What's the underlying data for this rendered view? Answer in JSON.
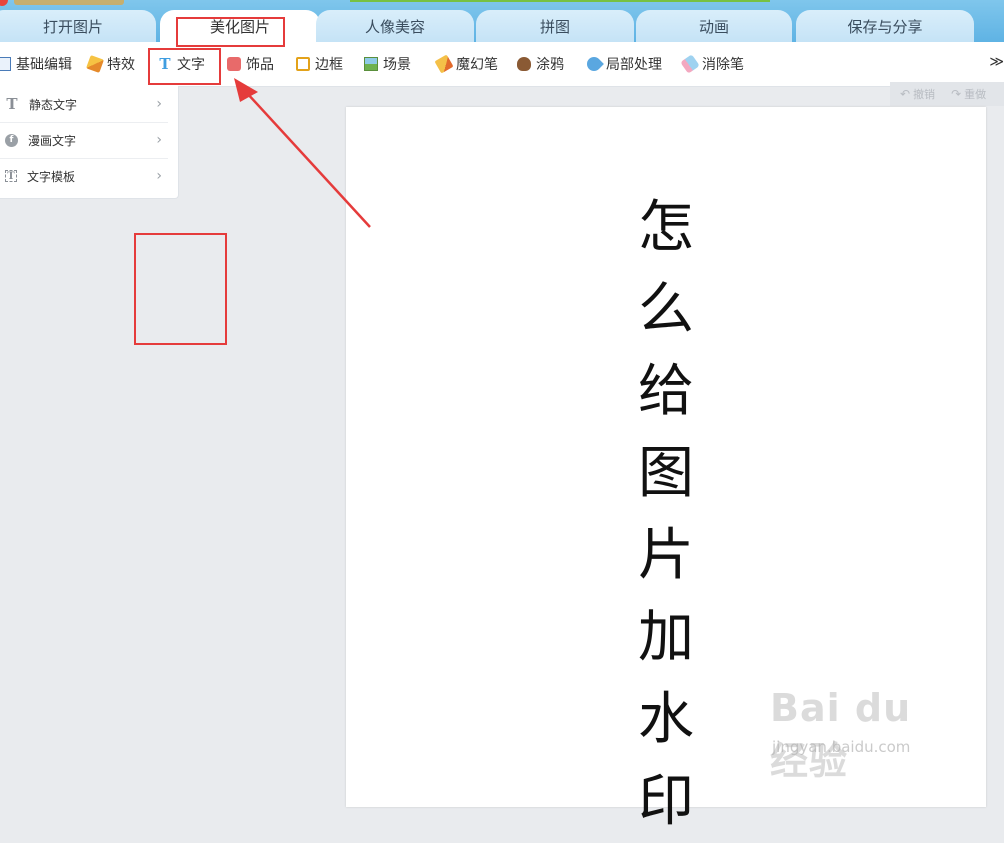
{
  "tabs": [
    {
      "label": "打开图片"
    },
    {
      "label": "美化图片",
      "active": true
    },
    {
      "label": "人像美容"
    },
    {
      "label": "拼图"
    },
    {
      "label": "动画"
    },
    {
      "label": "保存与分享"
    }
  ],
  "toolbar": {
    "items": [
      {
        "label": "基础编辑",
        "icon": "basic-edit-icon"
      },
      {
        "label": "特效",
        "icon": "effects-icon"
      },
      {
        "label": "文字",
        "icon": "text-icon"
      },
      {
        "label": "饰品",
        "icon": "decoration-icon"
      },
      {
        "label": "边框",
        "icon": "frame-icon"
      },
      {
        "label": "场景",
        "icon": "scene-icon"
      },
      {
        "label": "魔幻笔",
        "icon": "magic-pen-icon"
      },
      {
        "label": "涂鸦",
        "icon": "graffiti-icon"
      },
      {
        "label": "局部处理",
        "icon": "local-edit-icon"
      },
      {
        "label": "消除笔",
        "icon": "eraser-icon"
      }
    ],
    "more": "≫"
  },
  "side_panel": {
    "items": [
      {
        "label": "静态文字",
        "icon_glyph": "T"
      },
      {
        "label": "漫画文字",
        "icon_glyph": "f"
      },
      {
        "label": "文字模板",
        "icon_glyph": "T"
      }
    ]
  },
  "history": {
    "undo_label": "撤销",
    "redo_label": "重做"
  },
  "canvas": {
    "characters": [
      "怎",
      "么",
      "给",
      "图",
      "片",
      "加",
      "水",
      "印"
    ]
  },
  "watermark": {
    "main": "Bai du 经验",
    "sub": "jingyan.baidu.com"
  },
  "colors": {
    "highlight": "#e53b3b",
    "tab_bar": "#5fb3e4",
    "active_tab": "#ffffff"
  }
}
